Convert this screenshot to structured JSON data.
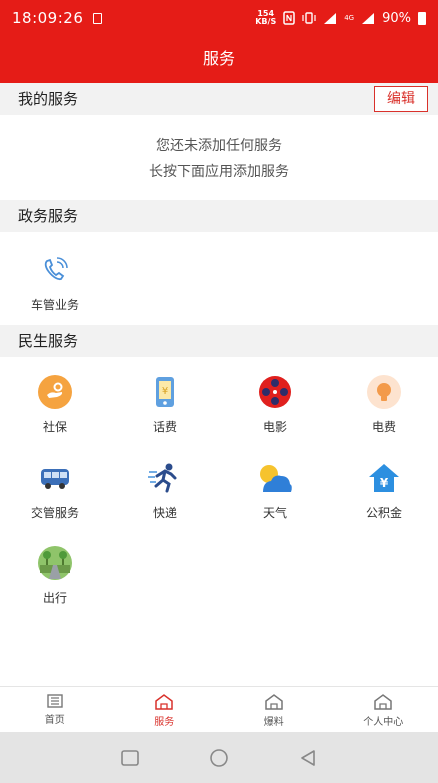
{
  "status": {
    "time": "18:09:26",
    "speed_top": "154",
    "speed_bottom": "KB/S",
    "battery": "90%",
    "net": "4G"
  },
  "header": {
    "title": "服务"
  },
  "my_services": {
    "title": "我的服务",
    "edit_label": "编辑",
    "empty_line1": "您还未添加任何服务",
    "empty_line2": "长按下面应用添加服务"
  },
  "gov_services": {
    "title": "政务服务",
    "items": [
      {
        "label": "车管业务",
        "icon": "phone-icon"
      }
    ]
  },
  "life_services": {
    "title": "民生服务",
    "items": [
      {
        "label": "社保",
        "icon": "social-security-icon"
      },
      {
        "label": "话费",
        "icon": "phone-bill-icon"
      },
      {
        "label": "电影",
        "icon": "film-reel-icon"
      },
      {
        "label": "电费",
        "icon": "lightbulb-icon"
      },
      {
        "label": "交管服务",
        "icon": "bus-icon"
      },
      {
        "label": "快递",
        "icon": "runner-icon"
      },
      {
        "label": "天气",
        "icon": "weather-icon"
      },
      {
        "label": "公积金",
        "icon": "house-fund-icon"
      },
      {
        "label": "出行",
        "icon": "travel-icon"
      }
    ]
  },
  "tabs": [
    {
      "label": "首页",
      "icon": "newspaper-icon",
      "active": false
    },
    {
      "label": "服务",
      "icon": "home-icon",
      "active": true
    },
    {
      "label": "爆料",
      "icon": "home-icon",
      "active": false
    },
    {
      "label": "个人中心",
      "icon": "home-icon",
      "active": false
    }
  ],
  "colors": {
    "brand": "#e51c17",
    "accent": "#d9312b"
  }
}
